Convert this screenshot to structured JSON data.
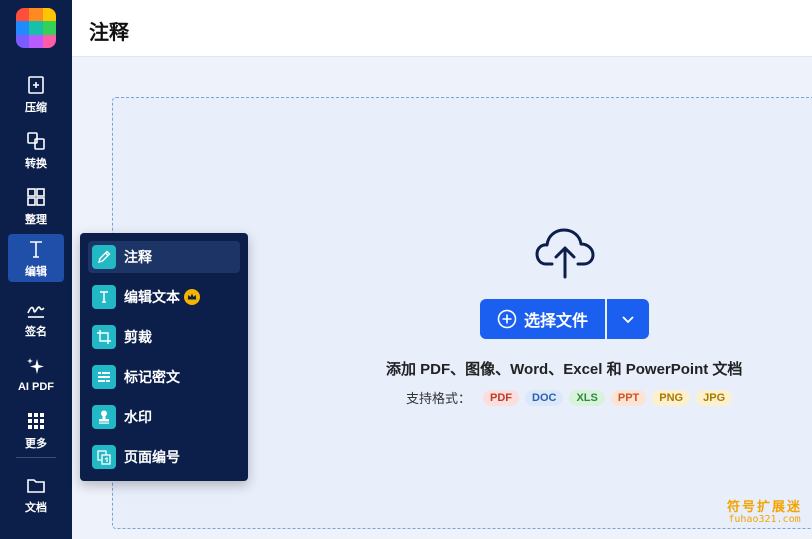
{
  "header": {
    "title": "注释"
  },
  "sidebar": {
    "items": [
      {
        "label": "压缩",
        "icon": "compress-icon"
      },
      {
        "label": "转换",
        "icon": "convert-icon"
      },
      {
        "label": "整理",
        "icon": "organize-icon"
      },
      {
        "label": "编辑",
        "icon": "edit-text-icon",
        "active": true
      },
      {
        "label": "签名",
        "icon": "signature-icon"
      },
      {
        "label": "AI PDF",
        "icon": "sparkle-icon"
      },
      {
        "label": "更多",
        "icon": "grid-dots-icon"
      }
    ],
    "bottom_item": {
      "label": "文档",
      "icon": "folder-icon"
    }
  },
  "edit_menu": {
    "items": [
      {
        "label": "注释",
        "icon": "pencil-icon",
        "active": true
      },
      {
        "label": "编辑文本",
        "icon": "text-icon",
        "premium": true
      },
      {
        "label": "剪裁",
        "icon": "crop-icon"
      },
      {
        "label": "标记密文",
        "icon": "redact-icon"
      },
      {
        "label": "水印",
        "icon": "stamp-icon"
      },
      {
        "label": "页面编号",
        "icon": "page-number-icon"
      }
    ]
  },
  "upload": {
    "button_label": "选择文件",
    "description": "添加 PDF、图像、Word、Excel 和 PowerPoint 文档",
    "formats_label": "支持格式：",
    "formats": [
      {
        "label": "PDF",
        "bg": "#fbdede",
        "fg": "#c0392b"
      },
      {
        "label": "DOC",
        "bg": "#dbe8fa",
        "fg": "#2b5fb3"
      },
      {
        "label": "XLS",
        "bg": "#d9f2dc",
        "fg": "#2e8b3e"
      },
      {
        "label": "PPT",
        "bg": "#fde3d3",
        "fg": "#c8562a"
      },
      {
        "label": "PNG",
        "bg": "#fdf0cf",
        "fg": "#a67c00"
      },
      {
        "label": "JPG",
        "bg": "#fdf0cf",
        "fg": "#a67c00"
      }
    ]
  },
  "watermark": {
    "line1": "符号扩展迷",
    "line2": "fuhao321.com"
  },
  "colors": {
    "sidebar": "#0b1f4a",
    "accent": "#1a5ff0",
    "menu_icon_bg": "#22b8c6",
    "crown": "#f5b400"
  }
}
